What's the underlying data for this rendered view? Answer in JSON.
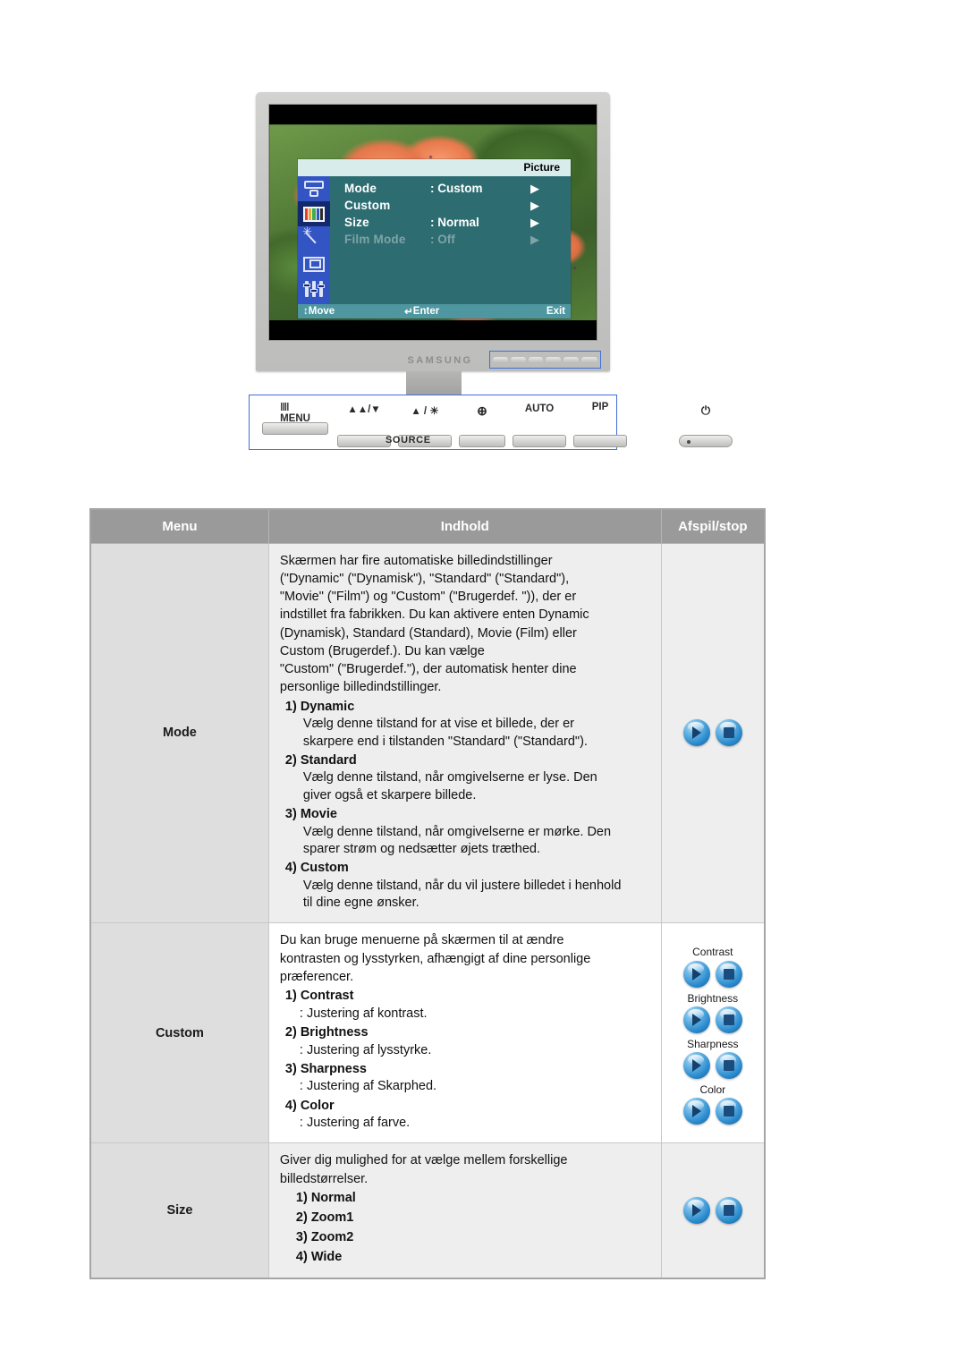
{
  "monitor": {
    "brand": "SAMSUNG",
    "osd": {
      "title": "Picture",
      "items": [
        {
          "label": "Mode",
          "value": ": Custom",
          "arrow": "▶",
          "dim": false
        },
        {
          "label": "Custom",
          "value": "",
          "arrow": "▶",
          "dim": false
        },
        {
          "label": "Size",
          "value": ": Normal",
          "arrow": "▶",
          "dim": false
        },
        {
          "label": "Film Mode",
          "value": ": Off",
          "arrow": "▶",
          "dim": true
        }
      ],
      "footer": {
        "move": "Move",
        "move_glyph": "↕",
        "enter": "Enter",
        "enter_glyph": "↵",
        "exit": "Exit",
        "exit_glyph": "‖"
      }
    },
    "controls": {
      "menu": "MENU",
      "menu_glyph": "‖‖",
      "down": "▲▲/▼",
      "up": "▲ / ☀",
      "source_icon": "⊕",
      "auto": "AUTO",
      "pip": "PIP",
      "power_glyph": "⏻",
      "source": "SOURCE"
    }
  },
  "table": {
    "headers": [
      "Menu",
      "Indhold",
      "Afspil/stop"
    ],
    "rows": [
      {
        "menu": "Mode",
        "intro": [
          "Skærmen har fire automatiske billedindstillinger",
          "(\"Dynamic\" (\"Dynamisk\"), \"Standard\" (\"Standard\"),",
          "\"Movie\" (\"Film\") og \"Custom\" (\"Brugerdef. \")), der er",
          "indstillet fra fabrikken. Du kan aktivere enten Dynamic",
          "(Dynamisk), Standard (Standard), Movie (Film) eller",
          "Custom (Brugerdef.). Du kan vælge",
          "\"Custom\" (\"Brugerdef.\"), der automatisk henter dine",
          "personlige billedindstillinger."
        ],
        "items": [
          {
            "heading": "1) Dynamic",
            "desc": [
              "Vælg denne tilstand for at vise et billede, der er",
              "skarpere end i tilstanden \"Standard\" (\"Standard\")."
            ]
          },
          {
            "heading": "2) Standard",
            "desc": [
              "Vælg denne tilstand, når omgivelserne er lyse. Den",
              "giver også et skarpere billede."
            ]
          },
          {
            "heading": "3) Movie",
            "desc": [
              "Vælg denne tilstand, når omgivelserne er mørke. Den",
              "sparer strøm og nedsætter øjets træthed."
            ]
          },
          {
            "heading": "4) Custom",
            "desc": [
              "Vælg denne tilstand, når du vil justere billedet i henhold",
              "til dine egne ønsker."
            ]
          }
        ],
        "buttons": [
          {
            "label": "",
            "play": "play-icon",
            "stop": "stop-icon"
          }
        ]
      },
      {
        "menu": "Custom",
        "intro": [
          "Du kan bruge menuerne på skærmen til at ændre",
          "kontrasten og lysstyrken, afhængigt af dine personlige",
          "præferencer."
        ],
        "items": [
          {
            "heading": "1) Contrast",
            "desc": [
              ": Justering af kontrast."
            ]
          },
          {
            "heading": "2) Brightness",
            "desc": [
              ": Justering af lysstyrke."
            ]
          },
          {
            "heading": "3) Sharpness",
            "desc": [
              ": Justering af Skarphed."
            ]
          },
          {
            "heading": "4) Color",
            "desc": [
              ": Justering af farve."
            ]
          }
        ],
        "buttons": [
          {
            "label": "Contrast",
            "play": "play-icon",
            "stop": "stop-icon"
          },
          {
            "label": "Brightness",
            "play": "play-icon",
            "stop": "stop-icon"
          },
          {
            "label": "Sharpness",
            "play": "play-icon",
            "stop": "stop-icon"
          },
          {
            "label": "Color",
            "play": "play-icon",
            "stop": "stop-icon"
          }
        ]
      },
      {
        "menu": "Size",
        "intro": [
          "Giver dig mulighed for at vælge mellem forskellige",
          "billedstørrelser."
        ],
        "options": [
          "1) Normal",
          "2) Zoom1",
          "3) Zoom2",
          "4) Wide"
        ],
        "buttons": [
          {
            "label": "",
            "play": "play-icon",
            "stop": "stop-icon"
          }
        ]
      }
    ]
  },
  "colors": {
    "header_bg": "#9a9a9a",
    "menu_col_bg": "#dedede",
    "row_alt_bg": "#eeeeee",
    "osd_bg": "#2d6d72",
    "osd_sidebar": "#3355c4",
    "osd_footer": "#4f97a0",
    "button_blue": "#2f8fd0",
    "highlight_border": "#3f6fd8"
  }
}
